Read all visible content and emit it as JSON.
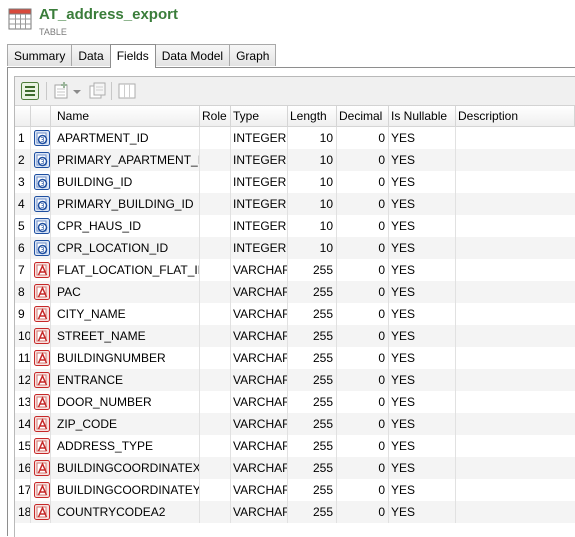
{
  "header": {
    "title": "AT_address_export",
    "subtitle": "TABLE",
    "icon": "table-icon"
  },
  "tabs": [
    {
      "label": "Summary",
      "active": false
    },
    {
      "label": "Data",
      "active": false
    },
    {
      "label": "Fields",
      "active": true
    },
    {
      "label": "Data Model",
      "active": false
    },
    {
      "label": "Graph",
      "active": false
    }
  ],
  "toolbar": {
    "icons": [
      "select-all-icon",
      "add-field-icon",
      "dropdown-arrow-icon",
      "copy-fields-icon",
      "view-columns-icon"
    ]
  },
  "grid": {
    "columns": [
      "",
      "",
      "Name",
      "Role",
      "Type",
      "Length",
      "Decimal",
      "Is Nullable",
      "Description"
    ],
    "rows": [
      {
        "index": "1",
        "name": "APARTMENT_ID",
        "role": "",
        "type": "INTEGER",
        "length": "10",
        "decimal": "0",
        "nullable": "YES",
        "description": "",
        "icon": "integer-field-icon"
      },
      {
        "index": "2",
        "name": "PRIMARY_APARTMENT_ID",
        "role": "",
        "type": "INTEGER",
        "length": "10",
        "decimal": "0",
        "nullable": "YES",
        "description": "",
        "icon": "integer-field-icon"
      },
      {
        "index": "3",
        "name": "BUILDING_ID",
        "role": "",
        "type": "INTEGER",
        "length": "10",
        "decimal": "0",
        "nullable": "YES",
        "description": "",
        "icon": "integer-field-icon"
      },
      {
        "index": "4",
        "name": "PRIMARY_BUILDING_ID",
        "role": "",
        "type": "INTEGER",
        "length": "10",
        "decimal": "0",
        "nullable": "YES",
        "description": "",
        "icon": "integer-field-icon"
      },
      {
        "index": "5",
        "name": "CPR_HAUS_ID",
        "role": "",
        "type": "INTEGER",
        "length": "10",
        "decimal": "0",
        "nullable": "YES",
        "description": "",
        "icon": "integer-field-icon"
      },
      {
        "index": "6",
        "name": "CPR_LOCATION_ID",
        "role": "",
        "type": "INTEGER",
        "length": "10",
        "decimal": "0",
        "nullable": "YES",
        "description": "",
        "icon": "integer-field-icon"
      },
      {
        "index": "7",
        "name": "FLAT_LOCATION_FLAT_ID",
        "role": "",
        "type": "VARCHAR",
        "length": "255",
        "decimal": "0",
        "nullable": "YES",
        "description": "",
        "icon": "string-field-icon"
      },
      {
        "index": "8",
        "name": "PAC",
        "role": "",
        "type": "VARCHAR",
        "length": "255",
        "decimal": "0",
        "nullable": "YES",
        "description": "",
        "icon": "string-field-icon"
      },
      {
        "index": "9",
        "name": "CITY_NAME",
        "role": "",
        "type": "VARCHAR",
        "length": "255",
        "decimal": "0",
        "nullable": "YES",
        "description": "",
        "icon": "string-field-icon"
      },
      {
        "index": "10",
        "name": "STREET_NAME",
        "role": "",
        "type": "VARCHAR",
        "length": "255",
        "decimal": "0",
        "nullable": "YES",
        "description": "",
        "icon": "string-field-icon"
      },
      {
        "index": "11",
        "name": "BUILDINGNUMBER",
        "role": "",
        "type": "VARCHAR",
        "length": "255",
        "decimal": "0",
        "nullable": "YES",
        "description": "",
        "icon": "string-field-icon"
      },
      {
        "index": "12",
        "name": "ENTRANCE",
        "role": "",
        "type": "VARCHAR",
        "length": "255",
        "decimal": "0",
        "nullable": "YES",
        "description": "",
        "icon": "string-field-icon"
      },
      {
        "index": "13",
        "name": "DOOR_NUMBER",
        "role": "",
        "type": "VARCHAR",
        "length": "255",
        "decimal": "0",
        "nullable": "YES",
        "description": "",
        "icon": "string-field-icon"
      },
      {
        "index": "14",
        "name": "ZIP_CODE",
        "role": "",
        "type": "VARCHAR",
        "length": "255",
        "decimal": "0",
        "nullable": "YES",
        "description": "",
        "icon": "string-field-icon"
      },
      {
        "index": "15",
        "name": "ADDRESS_TYPE",
        "role": "",
        "type": "VARCHAR",
        "length": "255",
        "decimal": "0",
        "nullable": "YES",
        "description": "",
        "icon": "string-field-icon"
      },
      {
        "index": "16",
        "name": "BUILDINGCOORDINATEX",
        "role": "",
        "type": "VARCHAR",
        "length": "255",
        "decimal": "0",
        "nullable": "YES",
        "description": "",
        "icon": "string-field-icon"
      },
      {
        "index": "17",
        "name": "BUILDINGCOORDINATEY",
        "role": "",
        "type": "VARCHAR",
        "length": "255",
        "decimal": "0",
        "nullable": "YES",
        "description": "",
        "icon": "string-field-icon"
      },
      {
        "index": "18",
        "name": "COUNTRYCODEA2",
        "role": "",
        "type": "VARCHAR",
        "length": "255",
        "decimal": "0",
        "nullable": "YES",
        "description": "",
        "icon": "string-field-icon"
      }
    ]
  },
  "colors": {
    "title": "#3a7d3a",
    "integer_icon": "#1f4fa0",
    "string_icon": "#c62828"
  }
}
